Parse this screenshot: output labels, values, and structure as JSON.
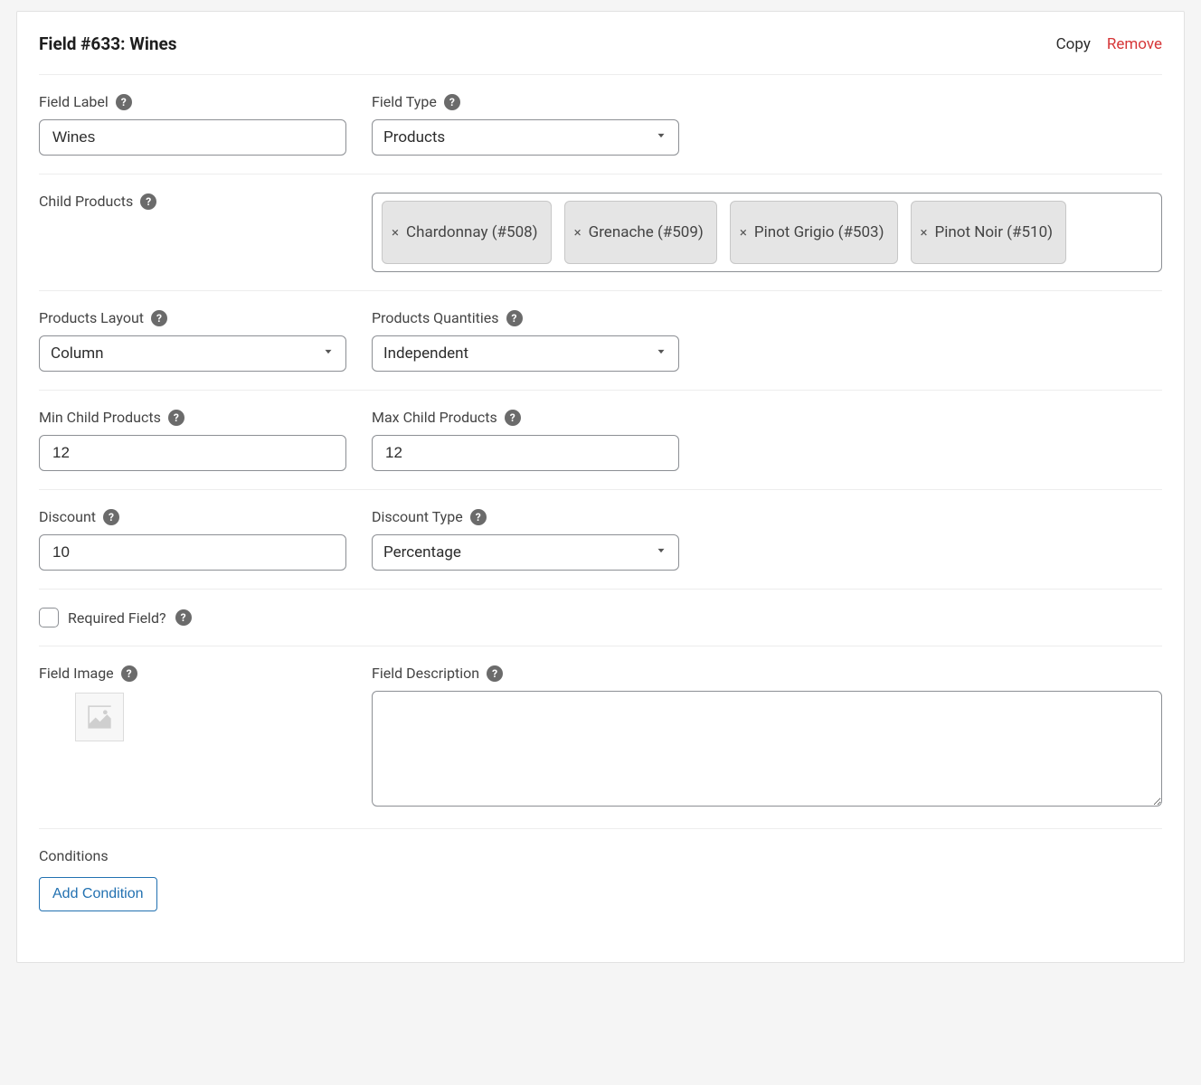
{
  "header": {
    "title": "Field #633: Wines",
    "copy": "Copy",
    "remove": "Remove"
  },
  "labels": {
    "field_label": "Field Label",
    "field_type": "Field Type",
    "child_products": "Child Products",
    "products_layout": "Products Layout",
    "products_quantities": "Products Quantities",
    "min_child": "Min Child Products",
    "max_child": "Max Child Products",
    "discount": "Discount",
    "discount_type": "Discount Type",
    "required": "Required Field?",
    "field_image": "Field Image",
    "field_description": "Field Description",
    "conditions": "Conditions",
    "add_condition": "Add Condition"
  },
  "values": {
    "field_label": "Wines",
    "field_type": "Products",
    "products_layout": "Column",
    "products_quantities": "Independent",
    "min_child": "12",
    "max_child": "12",
    "discount": "10",
    "discount_type": "Percentage",
    "field_description": ""
  },
  "child_products": [
    {
      "label": "Chardonnay (#508)"
    },
    {
      "label": "Grenache (#509)"
    },
    {
      "label": "Pinot Grigio (#503)"
    },
    {
      "label": "Pinot Noir (#510)"
    }
  ]
}
